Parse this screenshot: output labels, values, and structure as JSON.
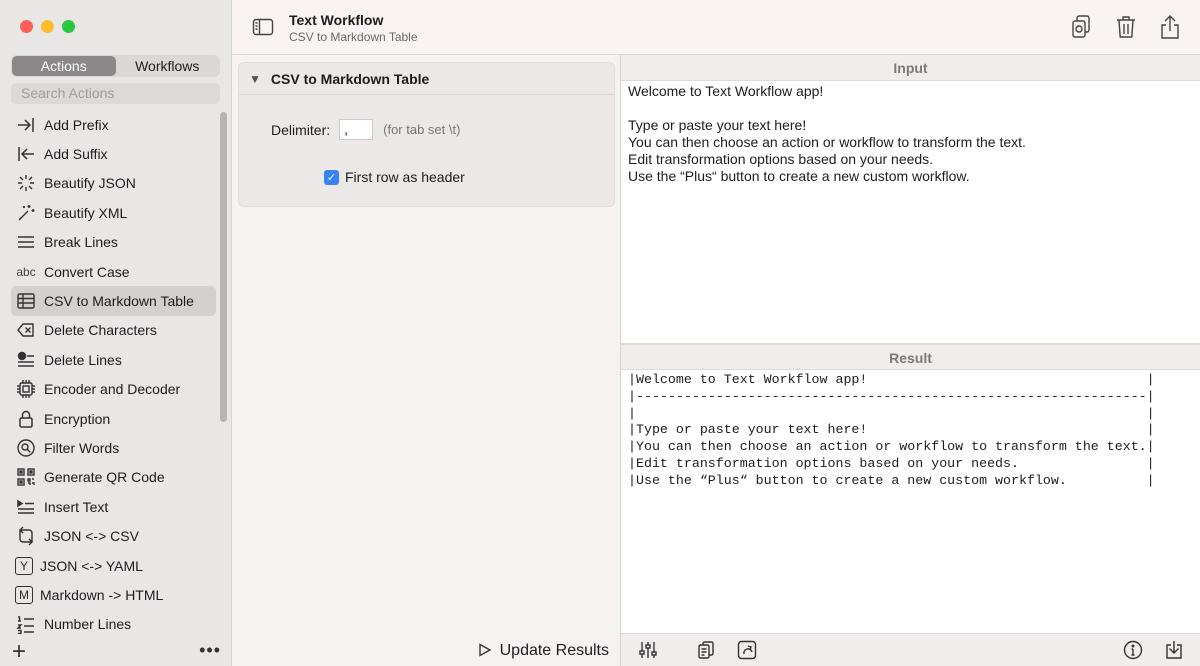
{
  "sidebar": {
    "tabs": [
      {
        "label": "Actions"
      },
      {
        "label": "Workflows"
      }
    ],
    "search_placeholder": "Search Actions",
    "items": [
      {
        "label": "Add Prefix",
        "icon": "arrow-right-to-line-icon"
      },
      {
        "label": "Add Suffix",
        "icon": "arrow-left-to-line-icon"
      },
      {
        "label": "Beautify JSON",
        "icon": "sparkle-icon"
      },
      {
        "label": "Beautify XML",
        "icon": "magic-wand-icon"
      },
      {
        "label": "Break Lines",
        "icon": "lines-icon"
      },
      {
        "label": "Convert Case",
        "icon": "abc-text-icon",
        "icon_text": "abc"
      },
      {
        "label": "CSV to Markdown Table",
        "icon": "table-icon"
      },
      {
        "label": "Delete Characters",
        "icon": "delete-left-icon"
      },
      {
        "label": "Delete Lines",
        "icon": "delete-lines-icon"
      },
      {
        "label": "Encoder and Decoder",
        "icon": "chip-icon"
      },
      {
        "label": "Encryption",
        "icon": "lock-icon"
      },
      {
        "label": "Filter Words",
        "icon": "magnifier-circle-icon"
      },
      {
        "label": "Generate QR Code",
        "icon": "qrcode-icon"
      },
      {
        "label": "Insert Text",
        "icon": "insert-text-icon"
      },
      {
        "label": "JSON <-> CSV",
        "icon": "convert-arrows-icon"
      },
      {
        "label": "JSON <-> YAML",
        "icon": "y-square-icon",
        "icon_text": "Y"
      },
      {
        "label": "Markdown -> HTML",
        "icon": "m-square-icon",
        "icon_text": "M"
      },
      {
        "label": "Number Lines",
        "icon": "numbered-list-icon"
      }
    ],
    "add_symbol": "+",
    "more_symbol": "•••"
  },
  "titlebar": {
    "title": "Text Workflow",
    "subtitle": "CSV to Markdown Table"
  },
  "action_panel": {
    "title": "CSV to Markdown Table",
    "delimiter_label": "Delimiter:",
    "delimiter_value": ",",
    "delimiter_hint": "(for tab set \\t)",
    "header_checkbox_label": "First row as header",
    "header_checked": true,
    "update_label": "Update Results"
  },
  "input": {
    "title": "Input",
    "text": "Welcome to Text Workflow app!\n\nType or paste your text here!\nYou can then choose an action or workflow to transform the text.\nEdit transformation options based on your needs.\nUse the “Plus“ button to create a new custom workflow."
  },
  "result": {
    "title": "Result",
    "text": "|Welcome to Text Workflow app!                                   |\n|----------------------------------------------------------------|\n|                                                                |\n|Type or paste your text here!                                   |\n|You can then choose an action or workflow to transform the text.|\n|Edit transformation options based on your needs.                |\n|Use the “Plus“ button to create a new custom workflow.          |"
  },
  "colors": {
    "accent": "#3a82f7",
    "close": "#fe5f57",
    "minimize": "#febc2e",
    "zoom": "#28c840"
  }
}
